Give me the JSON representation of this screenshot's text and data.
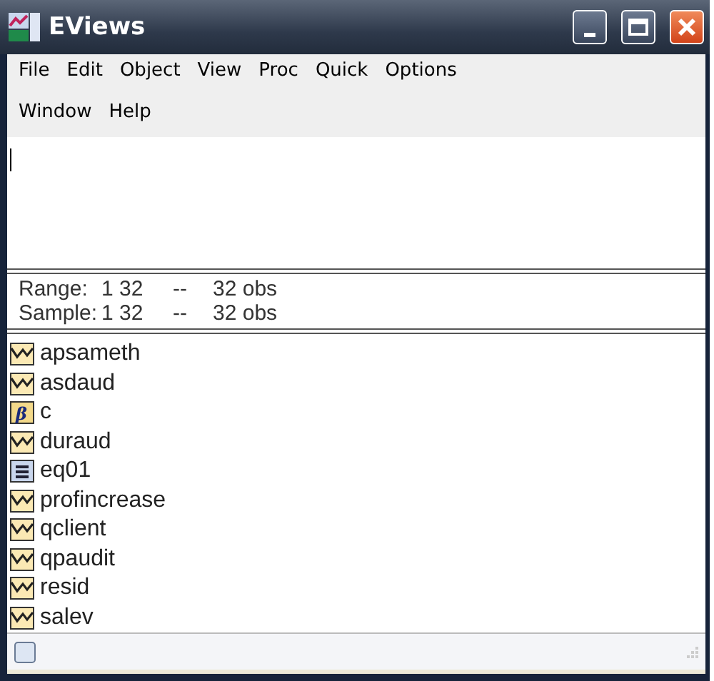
{
  "window": {
    "title": "EViews"
  },
  "menu": [
    "File",
    "Edit",
    "Object",
    "View",
    "Proc",
    "Quick",
    "Options",
    "Window",
    "Help"
  ],
  "workfile": {
    "range": {
      "label": "Range:",
      "span": "1 32",
      "sep": "--",
      "obs": "32 obs"
    },
    "sample": {
      "label": "Sample:",
      "span": "1 32",
      "sep": "--",
      "obs": "32 obs"
    }
  },
  "objects": [
    {
      "name": "apsameth",
      "kind": "series"
    },
    {
      "name": "asdaud",
      "kind": "series"
    },
    {
      "name": "c",
      "kind": "coef",
      "symbol": "β"
    },
    {
      "name": "duraud",
      "kind": "series"
    },
    {
      "name": "eq01",
      "kind": "equation"
    },
    {
      "name": "profincrease",
      "kind": "series"
    },
    {
      "name": "qclient",
      "kind": "series"
    },
    {
      "name": "qpaudit",
      "kind": "series"
    },
    {
      "name": "resid",
      "kind": "series"
    },
    {
      "name": "salev",
      "kind": "series"
    }
  ]
}
